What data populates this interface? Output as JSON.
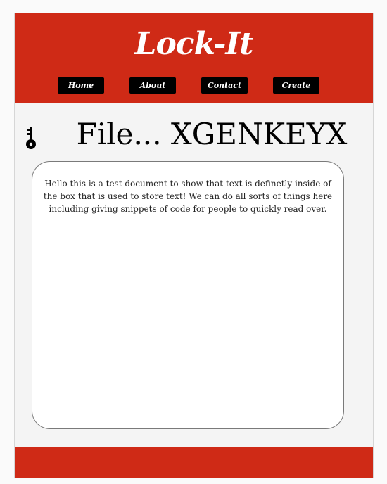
{
  "header": {
    "brand": "Lock-It",
    "nav": [
      {
        "label": "Home"
      },
      {
        "label": "About"
      },
      {
        "label": "Contact"
      },
      {
        "label": "Create"
      }
    ]
  },
  "main": {
    "key_icon": "key-icon",
    "file_title": "File... XGENKEYX",
    "document_text": "Hello this is a test document to show that text is definetly inside of the box that is used to store text! We can do all sorts of things here including giving snippets of code for people to quickly read over."
  },
  "colors": {
    "header_bg": "#cf2a16",
    "nav_bg": "#000000",
    "page_bg": "#f4f4f4",
    "doc_bg": "#ffffff"
  }
}
